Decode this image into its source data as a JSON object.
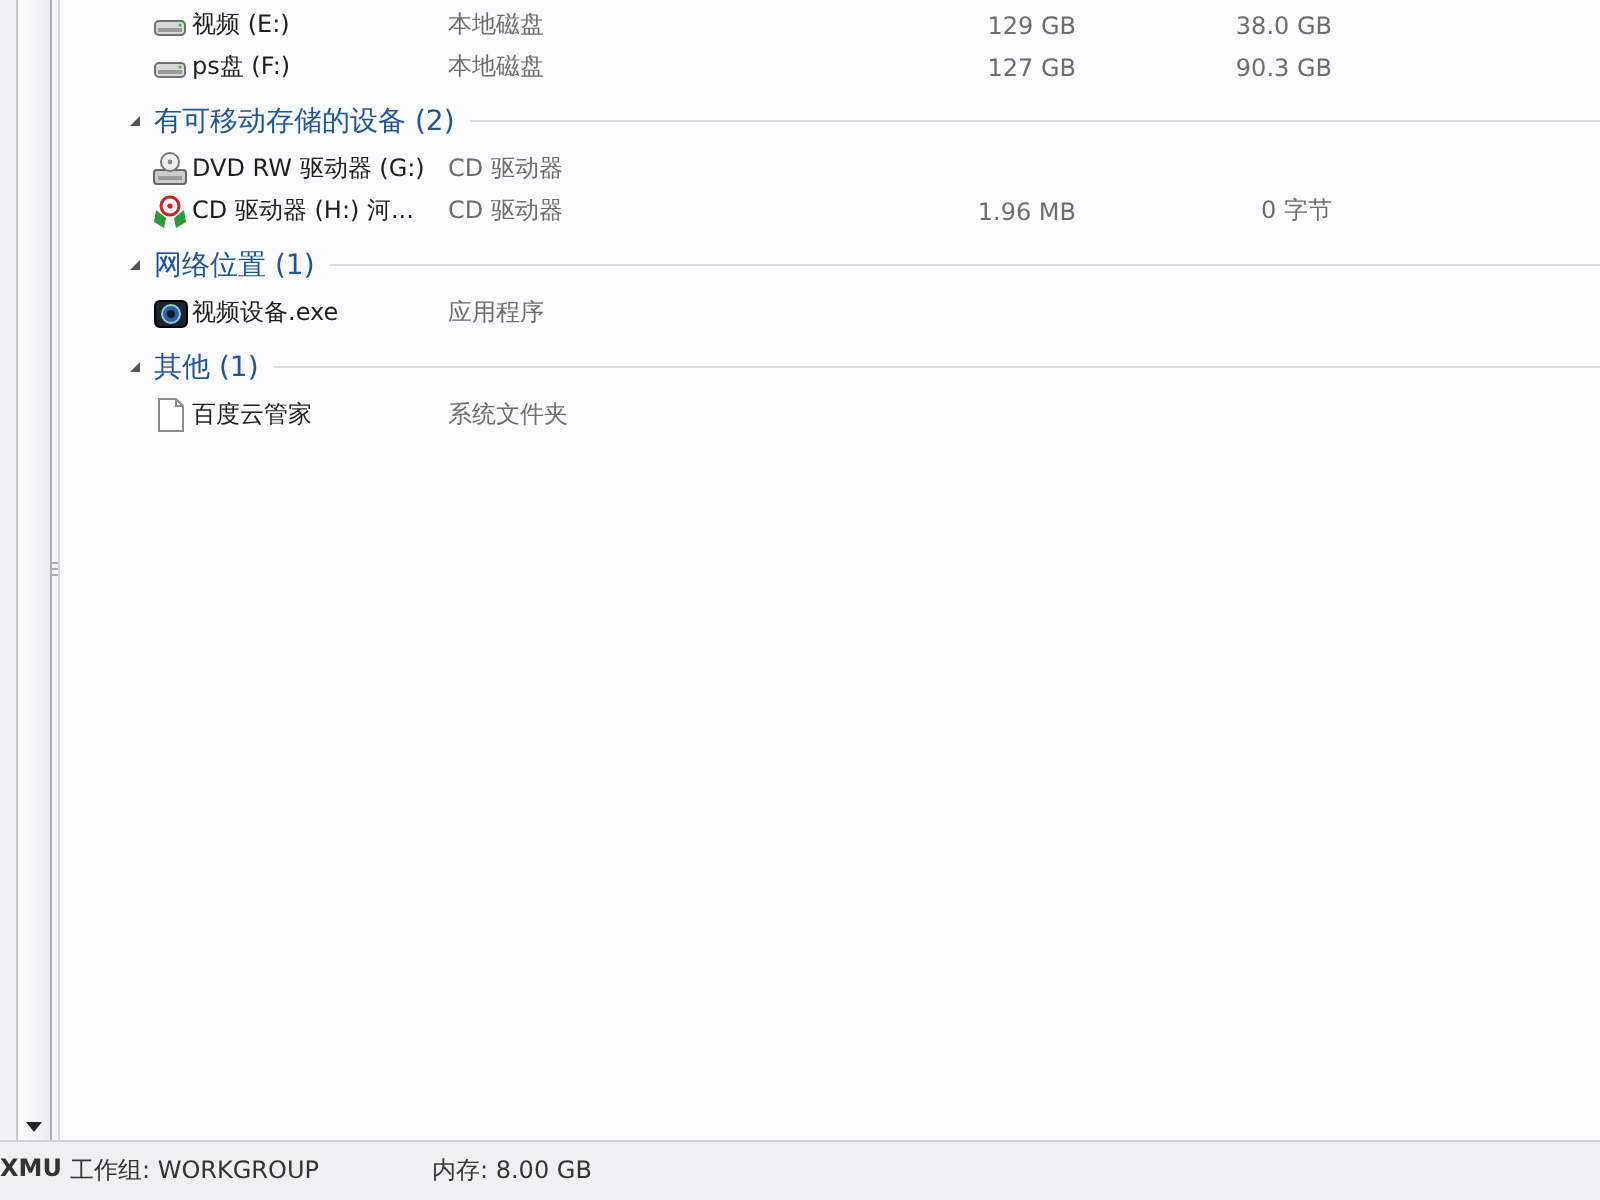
{
  "groups": [
    {
      "items": [
        {
          "kind": "disk",
          "name": "视频 (E:)",
          "type": "本地磁盘",
          "total": "129 GB",
          "free": "38.0 GB"
        },
        {
          "kind": "disk",
          "name": "ps盘 (F:)",
          "type": "本地磁盘",
          "total": "127 GB",
          "free": "90.3 GB"
        }
      ]
    },
    {
      "title": "有可移动存储的设备 (2)",
      "items": [
        {
          "kind": "dvd",
          "name": "DVD RW 驱动器 (G:)",
          "type": "CD 驱动器"
        },
        {
          "kind": "cd",
          "name": "CD 驱动器 (H:) 河...",
          "type": "CD 驱动器",
          "total": "1.96 MB",
          "free": "0 字节"
        }
      ]
    },
    {
      "title": "网络位置 (1)",
      "items": [
        {
          "kind": "app",
          "name": "视频设备.exe",
          "type": "应用程序"
        }
      ]
    },
    {
      "title": "其他 (1)",
      "items": [
        {
          "kind": "file",
          "name": "百度云管家",
          "type": "系统文件夹"
        }
      ]
    }
  ],
  "status_bar": {
    "computer": "XMU",
    "workgroup": "工作组: WORKGROUP",
    "memory": "内存: 8.00 GB"
  }
}
